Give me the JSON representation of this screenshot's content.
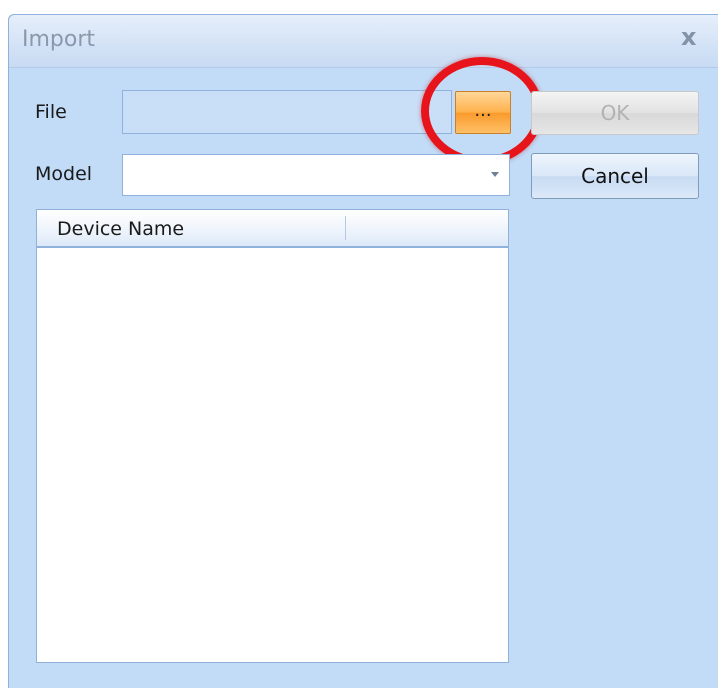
{
  "dialog": {
    "title": "Import",
    "close_symbol": "x"
  },
  "file": {
    "label": "File",
    "value": "",
    "browse_label": "...",
    "browse_icon": "ellipsis"
  },
  "model": {
    "label": "Model",
    "selected": ""
  },
  "buttons": {
    "ok_label": "OK",
    "ok_enabled": false,
    "cancel_label": "Cancel"
  },
  "device_list": {
    "columns": [
      "Device Name"
    ],
    "rows": []
  },
  "annotation": {
    "highlight_color": "#e8141b"
  },
  "colors": {
    "dialog_background": "#c2dbf7",
    "browse_button_accent": "#ffb04a"
  }
}
